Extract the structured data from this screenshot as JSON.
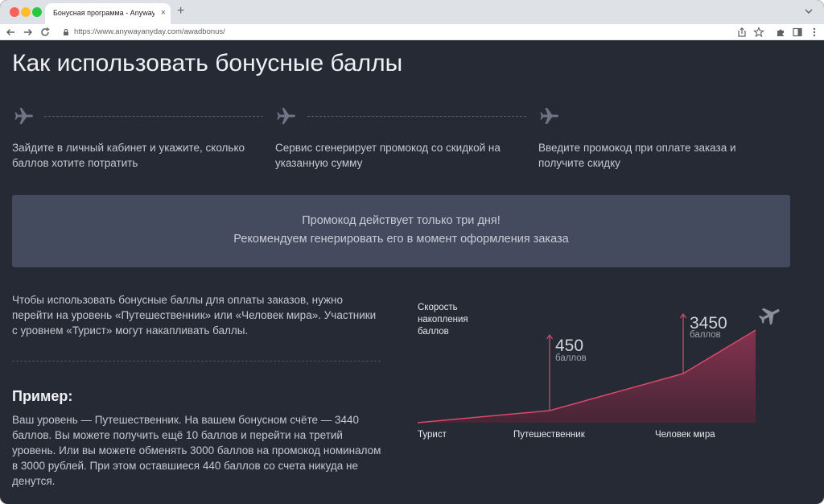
{
  "browser": {
    "tab_title": "Бонусная программа - Anywayanyday",
    "tab_close": "×",
    "new_tab": "+",
    "url": "https://www.anywayanyday.com/awadbonus/"
  },
  "page": {
    "title": "Как использовать бонусные баллы",
    "steps": [
      {
        "text": "Зайдите в личный кабинет и укажите, сколько баллов хотите потратить",
        "icon": "plane-icon"
      },
      {
        "text": "Сервис сгенерирует промокод со скидкой на указанную сумму",
        "icon": "plane-icon"
      },
      {
        "text": "Введите промокод при оплате заказа и получите скидку",
        "icon": "plane-icon"
      }
    ],
    "notice": {
      "line1": "Промокод действует только три дня!",
      "line2": "Рекомендуем генерировать его в момент оформления заказа"
    },
    "levels_paragraph": "Чтобы использовать бонусные баллы для оплаты заказов, нужно перейти на уровень «Путешественник» или «Человек мира». Участники с уровнем «Турист» могут накапливать баллы.",
    "example_heading": "Пример:",
    "example_paragraph": "Ваш уровень — Путешественник. На вашем бонусном счёте — 3440 баллов. Вы можете получить ещё 10 баллов и перейти на третий уровень. Или вы можете обменять 3000 баллов на промокод номиналом в 3000 рублей. При этом оставшиеся 440 баллов со счета никуда не денутся."
  },
  "chart_data": {
    "type": "area",
    "title_lines": [
      "Скорость",
      "накопления",
      "баллов"
    ],
    "categories": [
      "Турист",
      "Путешественник",
      "Человек мира"
    ],
    "markers": [
      {
        "category": "Путешественник",
        "value": "450",
        "unit": "баллов"
      },
      {
        "category": "Человек мира",
        "value": "3450",
        "unit": "баллов"
      }
    ],
    "colors": {
      "line": "#d9496b",
      "fill": "#7a2d44",
      "axis_text": "#e6e8ec",
      "marker_value": "#cfd3da"
    }
  }
}
